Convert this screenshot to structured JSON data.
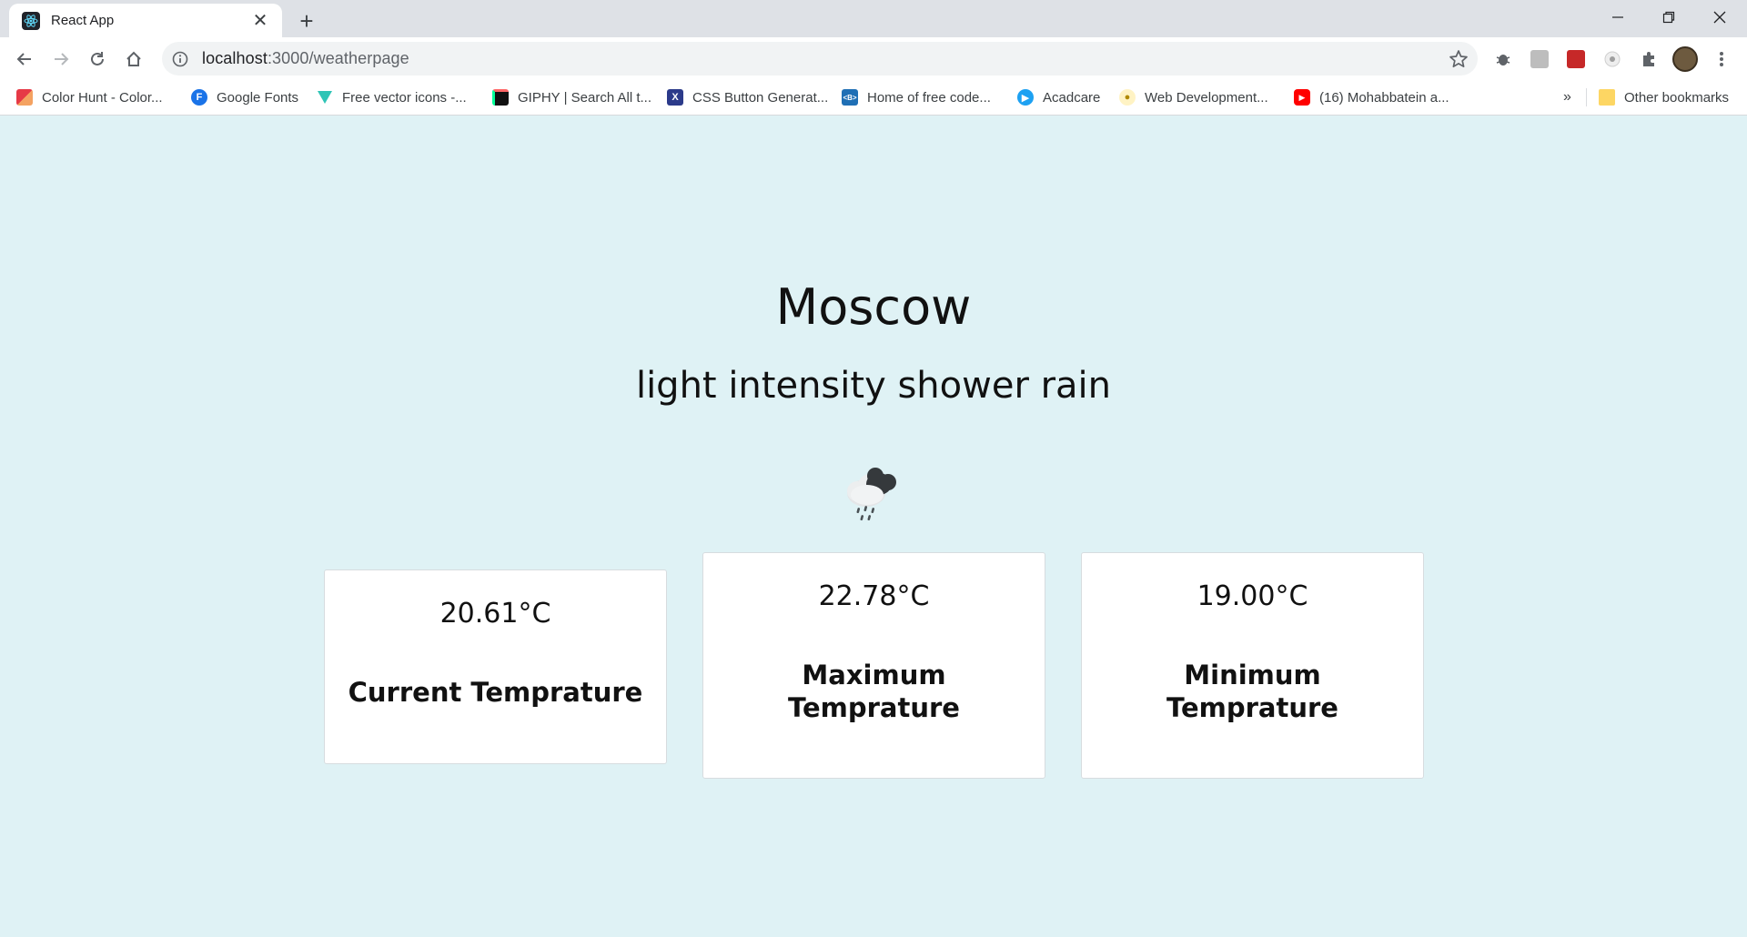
{
  "browser": {
    "tab_title": "React App",
    "url_host": "localhost",
    "url_path": ":3000/weatherpage",
    "bookmarks": [
      {
        "label": "Color Hunt - Color...",
        "icon": "color-hunt-icon",
        "color": "#e63946"
      },
      {
        "label": "Google Fonts",
        "icon": "google-fonts-icon",
        "color": "#1a73e8"
      },
      {
        "label": "Free vector icons -...",
        "icon": "vector-icons-icon",
        "color": "#2ec4b6"
      },
      {
        "label": "GIPHY | Search All t...",
        "icon": "giphy-icon",
        "color": "#111111"
      },
      {
        "label": "CSS Button Generat...",
        "icon": "css-button-icon",
        "color": "#2b3a8a"
      },
      {
        "label": "Home of free code...",
        "icon": "free-code-icon",
        "color": "#1f6fb5"
      },
      {
        "label": "Acadcare",
        "icon": "acadcare-icon",
        "color": "#1da1f2"
      },
      {
        "label": "Web Development...",
        "icon": "web-dev-icon",
        "color": "#e0b400"
      },
      {
        "label": "(16) Mohabbatein a...",
        "icon": "youtube-icon",
        "color": "#ff0000"
      }
    ],
    "overflow_label": "»",
    "other_bookmarks_label": "Other bookmarks"
  },
  "weather": {
    "city": "Moscow",
    "description": "light intensity shower rain",
    "icon": "shower-rain-icon",
    "cards": [
      {
        "value": "20.61°C",
        "label_line1": "Current Temprature",
        "label_line2": ""
      },
      {
        "value": "22.78°C",
        "label_line1": "Maximum",
        "label_line2": "Temprature"
      },
      {
        "value": "19.00°C",
        "label_line1": "Minimum",
        "label_line2": "Temprature"
      }
    ]
  },
  "colors": {
    "page_background": "#dff2f5",
    "card_background": "#ffffff"
  }
}
